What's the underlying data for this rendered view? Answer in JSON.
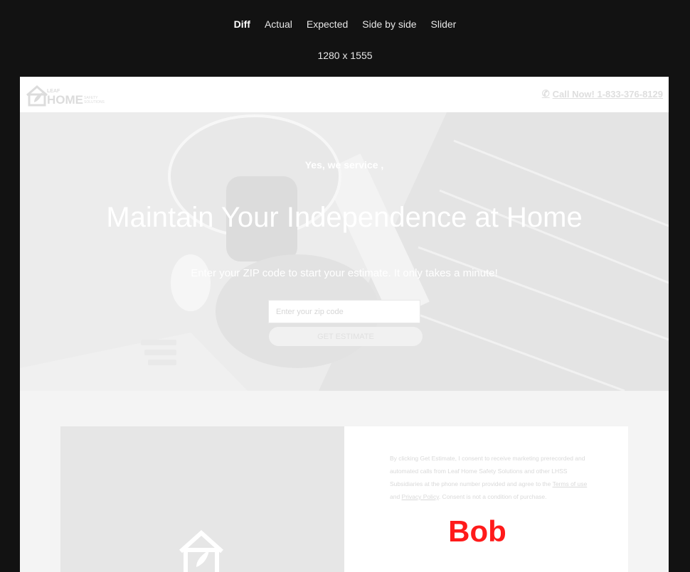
{
  "viewer": {
    "tabs": [
      "Diff",
      "Actual",
      "Expected",
      "Side by side",
      "Slider"
    ],
    "active_tab": "Diff",
    "dimensions": "1280 x 1555"
  },
  "page": {
    "header": {
      "logo_icon": "leaf-house-logo",
      "phone_icon": "phone-icon",
      "call_text": "Call Now! 1-833-376-8129"
    },
    "hero": {
      "eyebrow": "Yes, we service ,",
      "headline": "Maintain Your Independence at Home",
      "subheadline": "Enter your ZIP code to start your estimate. It only takes a minute!",
      "zip_placeholder": "Enter your zip code",
      "cta_label": "GET ESTIMATE"
    },
    "consent": {
      "text_before": "By clicking Get Estimate, I consent to receive marketing prerecorded and automated calls from Leaf Home Safety Solutions and other LHSS Subsidiaries at the phone number provided and agree to the ",
      "terms_link": "Terms of use",
      "and_text": " and ",
      "privacy_link": "Privacy Policy",
      "text_after": ". Consent is not a condition of purchase."
    },
    "overlay_name": "Bob"
  }
}
